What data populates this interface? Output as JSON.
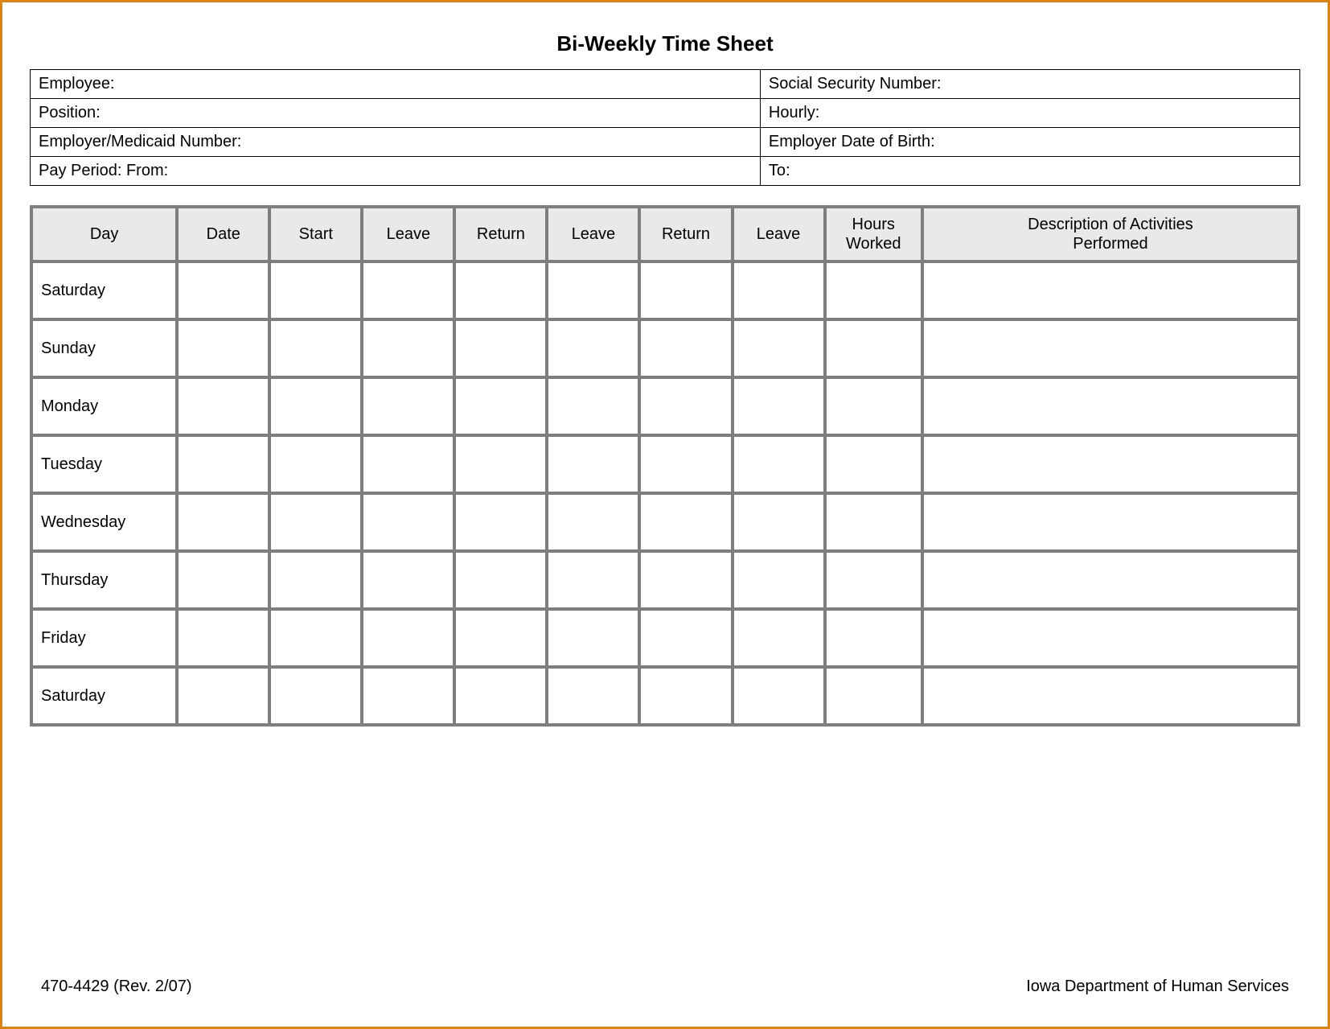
{
  "title": "Bi-Weekly Time Sheet",
  "info": {
    "employee_label": "Employee:",
    "ssn_label": "Social Security Number:",
    "position_label": "Position:",
    "hourly_label": "Hourly:",
    "employer_medicaid_label": "Employer/Medicaid Number:",
    "employer_dob_label": "Employer Date of Birth:",
    "pay_period_from_label": "Pay Period:  From:",
    "pay_period_to_label": "To:"
  },
  "columns": {
    "day": "Day",
    "date": "Date",
    "start": "Start",
    "leave1": "Leave",
    "return1": "Return",
    "leave2": "Leave",
    "return2": "Return",
    "leave3": "Leave",
    "hours_worked_l1": "Hours",
    "hours_worked_l2": "Worked",
    "description_l1": "Description of Activities",
    "description_l2": "Performed"
  },
  "rows": [
    {
      "day": "Saturday"
    },
    {
      "day": "Sunday"
    },
    {
      "day": "Monday"
    },
    {
      "day": "Tuesday"
    },
    {
      "day": "Wednesday"
    },
    {
      "day": "Thursday"
    },
    {
      "day": "Friday"
    },
    {
      "day": "Saturday"
    }
  ],
  "footer": {
    "form_id": "470-4429  (Rev. 2/07)",
    "agency": "Iowa Department of Human Services"
  },
  "col_widths": {
    "day": "11.5%",
    "date": "7.3%",
    "start": "7.3%",
    "leave1": "7.3%",
    "return1": "7.3%",
    "leave2": "7.3%",
    "return2": "7.3%",
    "leave3": "7.3%",
    "hours": "7.7%",
    "desc": "29.7%"
  }
}
